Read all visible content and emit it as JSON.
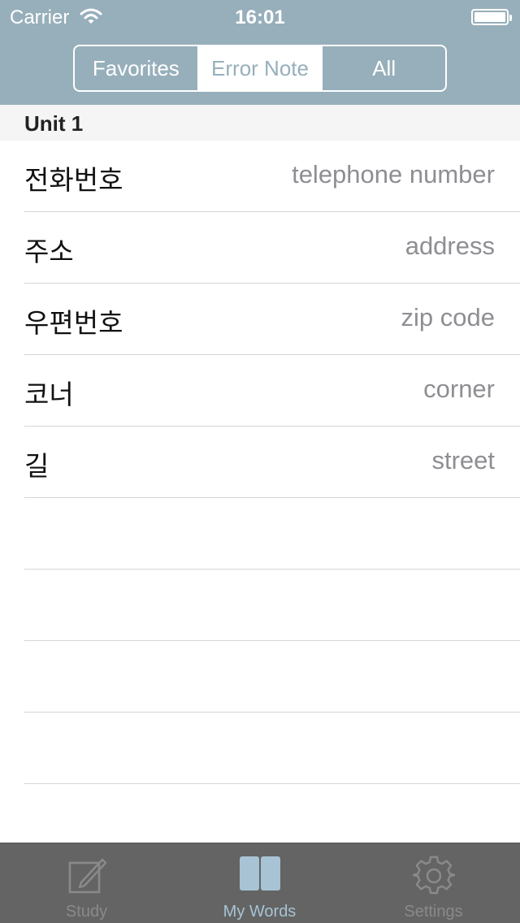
{
  "status_bar": {
    "carrier": "Carrier",
    "time": "16:01",
    "wifi_icon": "wifi-icon",
    "battery_icon": "battery-icon"
  },
  "segmented_control": {
    "options": [
      "Favorites",
      "Error Note",
      "All"
    ],
    "selected": "Error Note"
  },
  "section": {
    "title": "Unit 1"
  },
  "words": [
    {
      "korean": "전화번호",
      "english": "telephone number"
    },
    {
      "korean": "주소",
      "english": "address"
    },
    {
      "korean": "우편번호",
      "english": "zip code"
    },
    {
      "korean": "코너",
      "english": "corner"
    },
    {
      "korean": "길",
      "english": "street"
    }
  ],
  "tab_bar": {
    "tabs": [
      {
        "label": "Study",
        "icon": "pencil-square-icon"
      },
      {
        "label": "My Words",
        "icon": "open-book-icon"
      },
      {
        "label": "Settings",
        "icon": "gear-icon"
      }
    ],
    "active": "My Words"
  },
  "colors": {
    "header_bg": "#97afbb",
    "tab_bar_bg": "#646464",
    "tab_active": "#a7c3d4",
    "tab_inactive": "#8a8a8a",
    "secondary_text": "#8e8e93"
  }
}
